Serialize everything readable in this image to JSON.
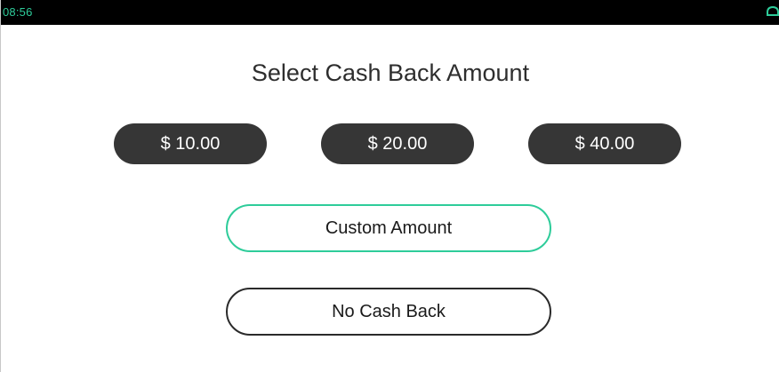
{
  "status_bar": {
    "time": "08:56",
    "accent_color": "#2ecc9a",
    "icon": "connection-icon"
  },
  "title": "Select Cash Back Amount",
  "amounts": [
    {
      "label": "$ 10.00"
    },
    {
      "label": "$ 20.00"
    },
    {
      "label": "$ 40.00"
    }
  ],
  "custom_button": {
    "label": "Custom Amount",
    "border_color": "#2ecc9a"
  },
  "no_cash_back_button": {
    "label": "No Cash Back"
  },
  "colors": {
    "amount_button_bg": "#363636",
    "amount_button_text": "#ffffff"
  }
}
